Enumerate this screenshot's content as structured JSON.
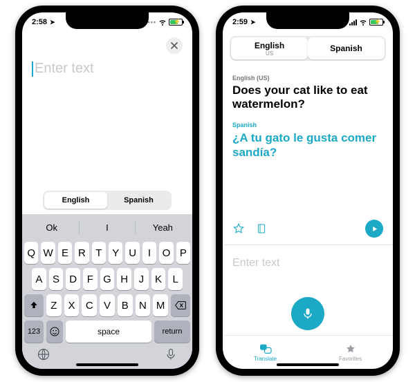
{
  "left": {
    "status_time": "2:58",
    "input_placeholder": "Enter text",
    "segment": {
      "source": "English",
      "target": "Spanish"
    },
    "suggestions": [
      "Ok",
      "I",
      "Yeah"
    ],
    "keys_row1": [
      "Q",
      "W",
      "E",
      "R",
      "T",
      "Y",
      "U",
      "I",
      "O",
      "P"
    ],
    "keys_row2": [
      "A",
      "S",
      "D",
      "F",
      "G",
      "H",
      "J",
      "K",
      "L"
    ],
    "keys_row3": [
      "Z",
      "X",
      "C",
      "V",
      "B",
      "N",
      "M"
    ],
    "key_123": "123",
    "key_space": "space",
    "key_return": "return"
  },
  "right": {
    "status_time": "2:59",
    "segment": {
      "source_label": "English",
      "source_sub": "US",
      "target_label": "Spanish"
    },
    "source": {
      "lang_label": "English (US)",
      "text": "Does your cat like to eat watermelon?"
    },
    "target": {
      "lang_label": "Spanish",
      "text": "¿A tu gato le gusta comer sandía?"
    },
    "input_placeholder": "Enter text",
    "tabs": {
      "translate": "Translate",
      "favorites": "Favorites"
    }
  }
}
